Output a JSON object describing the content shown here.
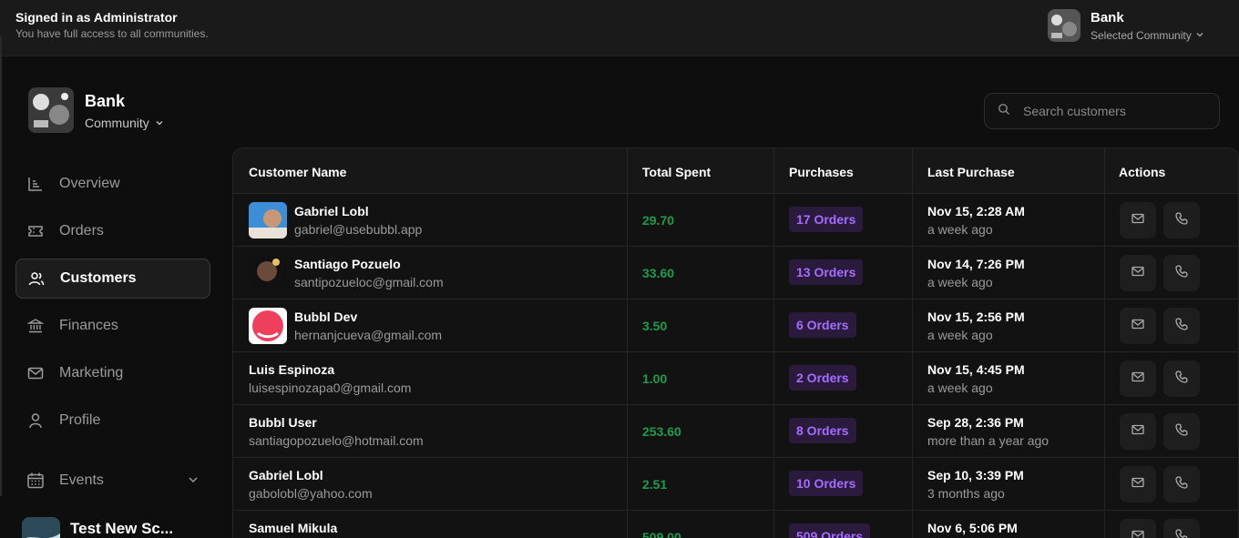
{
  "topbar": {
    "signed_in": "Signed in as Administrator",
    "access_note": "You have full access to all communities.",
    "community_name": "Bank",
    "community_sub": "Selected Community"
  },
  "sidebar": {
    "brand_name": "Bank",
    "brand_sub": "Community",
    "items": [
      {
        "label": "Overview",
        "icon": "chart-icon"
      },
      {
        "label": "Orders",
        "icon": "ticket-icon"
      },
      {
        "label": "Customers",
        "icon": "users-icon",
        "active": true
      },
      {
        "label": "Finances",
        "icon": "bank-icon"
      },
      {
        "label": "Marketing",
        "icon": "mail-icon"
      },
      {
        "label": "Profile",
        "icon": "user-icon"
      },
      {
        "label": "Events",
        "icon": "calendar-icon"
      }
    ],
    "event_name": "Test New Sc..."
  },
  "search": {
    "placeholder": "Search customers"
  },
  "table": {
    "headers": [
      "Customer Name",
      "Total Spent",
      "Purchases",
      "Last Purchase",
      "Actions"
    ],
    "rows": [
      {
        "name": "Gabriel Lobl",
        "email": "gabriel@usebubbl.app",
        "spent": "29.70",
        "orders": "17 Orders",
        "date": "Nov 15, 2:28 AM",
        "ago": "a week ago"
      },
      {
        "name": "Santiago Pozuelo",
        "email": "santipozueloc@gmail.com",
        "spent": "33.60",
        "orders": "13 Orders",
        "date": "Nov 14, 7:26 PM",
        "ago": "a week ago"
      },
      {
        "name": "Bubbl Dev",
        "email": "hernanjcueva@gmail.com",
        "spent": "3.50",
        "orders": "6 Orders",
        "date": "Nov 15, 2:56 PM",
        "ago": "a week ago"
      },
      {
        "name": "Luis Espinoza",
        "email": "luisespinozapa0@gmail.com",
        "spent": "1.00",
        "orders": "2 Orders",
        "date": "Nov 15, 4:45 PM",
        "ago": "a week ago"
      },
      {
        "name": "Bubbl User",
        "email": "santiagopozuelo@hotmail.com",
        "spent": "253.60",
        "orders": "8 Orders",
        "date": "Sep 28, 2:36 PM",
        "ago": "more than a year ago"
      },
      {
        "name": "Gabriel Lobl",
        "email": "gabolobl@yahoo.com",
        "spent": "2.51",
        "orders": "10 Orders",
        "date": "Sep 10, 3:39 PM",
        "ago": "3 months ago"
      },
      {
        "name": "Samuel Mikula",
        "email": "",
        "spent": "509.00",
        "orders": "509 Orders",
        "date": "Nov 6, 5:06 PM",
        "ago": ""
      }
    ]
  },
  "colors": {
    "spent": "#1d9c4e",
    "orders_text": "#a66cff",
    "orders_bg": "#2a1b3d"
  }
}
